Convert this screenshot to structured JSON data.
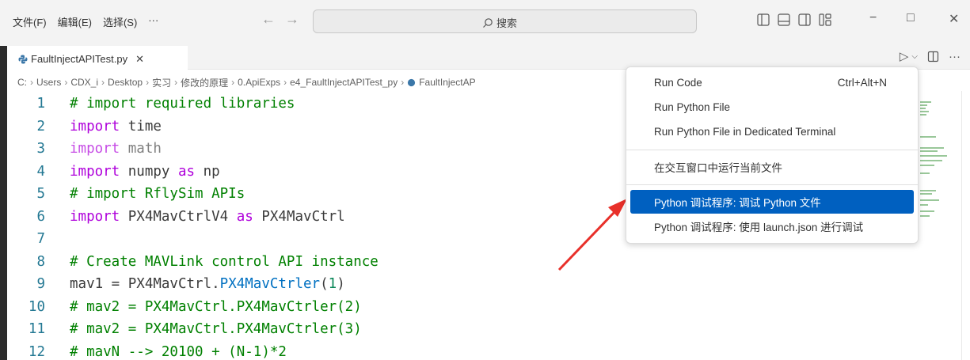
{
  "menu": {
    "file": "文件(F)",
    "edit": "编辑(E)",
    "selection": "选择(S)",
    "more": "···"
  },
  "nav": {
    "back": "←",
    "forward": "→"
  },
  "search": {
    "label": "搜索",
    "icon": "search-icon"
  },
  "window": {
    "minimize": "−",
    "maximize": "□",
    "close": "✕"
  },
  "tab": {
    "label": "FaultInjectAPITest.py",
    "close": "✕",
    "icon": "python-file-icon"
  },
  "editor_actions": {
    "run": "▷",
    "run_menu": "⌵",
    "split": "split-editor-icon",
    "more": "···"
  },
  "breadcrumb": [
    "C:",
    "Users",
    "CDX_i",
    "Desktop",
    "实习",
    "修改的原理",
    "0.ApiExps",
    "e4_FaultInjectAPITest_py",
    "FaultInjectAP"
  ],
  "code_lines": [
    {
      "n": "1"
    },
    {
      "n": "2"
    },
    {
      "n": "3"
    },
    {
      "n": "4"
    },
    {
      "n": "5"
    },
    {
      "n": "6"
    },
    {
      "n": "7"
    },
    {
      "n": "8"
    },
    {
      "n": "9"
    },
    {
      "n": "10"
    },
    {
      "n": "11"
    },
    {
      "n": "12"
    }
  ],
  "code": {
    "l1": "# import required libraries",
    "l2_kw": "import",
    "l2_mod": " time",
    "l3_kw": "import",
    "l3_mod": " math",
    "l4_kw": "import",
    "l4_mod": " numpy ",
    "l4_as": "as",
    "l4_alias": " np",
    "l5": "# import RflySim APIs",
    "l6_kw": "import",
    "l6_mod": " PX4MavCtrlV4 ",
    "l6_as": "as",
    "l6_alias": " PX4MavCtrl",
    "l8": "# Create MAVLink control API instance",
    "l9_a": "mav1 = PX4MavCtrl.",
    "l9_b": "PX4MavCtrler",
    "l9_c": "(",
    "l9_d": "1",
    "l9_e": ")",
    "l10": "# mav2 = PX4MavCtrl.PX4MavCtrler(2)",
    "l11": "# mav2 = PX4MavCtrl.PX4MavCtrler(3)",
    "l12": "# mavN --> 20100 + (N-1)*2"
  },
  "dropdown": {
    "run_code": "Run Code",
    "run_code_kb": "Ctrl+Alt+N",
    "run_python_file": "Run Python File",
    "run_dedicated": "Run Python File in Dedicated Terminal",
    "run_interactive": "在交互窗口中运行当前文件",
    "debug_python": "Python 调试程序: 调试 Python 文件",
    "debug_launch": "Python 调试程序: 使用 launch.json 进行调试"
  },
  "colors": {
    "accent": "#0060c0",
    "arrow": "#e8302a",
    "comment": "#008000",
    "keyword": "#af00db",
    "line_number": "#237893"
  }
}
